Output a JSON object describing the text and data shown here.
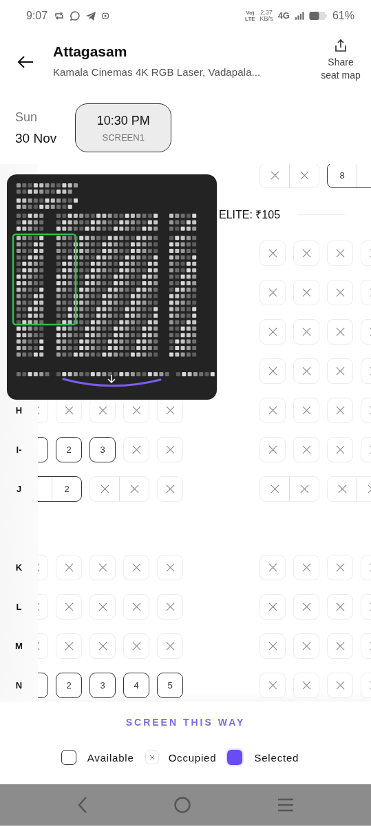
{
  "status_bar": {
    "time": "9:07",
    "volte_top": "Vo)",
    "volte_bottom": "LTE",
    "speed": "2.37",
    "speed_unit": "KB/s",
    "network": "4G",
    "battery": "61%"
  },
  "header": {
    "title": "Attagasam",
    "subtitle": "Kamala Cinemas 4K RGB Laser, Vadapala...",
    "share": "Share seat map"
  },
  "date": {
    "day": "Sun",
    "date": "30 Nov"
  },
  "showtimes": [
    {
      "time": "10:30 PM",
      "screen": "SCREEN1",
      "selected": true
    }
  ],
  "seat_rows": [
    {
      "kind": "row",
      "right": [
        [
          {
            "kind": "occupied"
          },
          {
            "kind": "occupied"
          }
        ],
        [
          {
            "kind": "available",
            "number": "8"
          },
          {
            "kind": "available"
          }
        ]
      ]
    },
    {
      "kind": "section",
      "label": "ELITE: ₹105"
    },
    {
      "kind": "row",
      "right": [
        [
          {
            "kind": "occupied"
          }
        ],
        [
          {
            "kind": "occupied"
          }
        ],
        [
          {
            "kind": "occupied"
          }
        ],
        [
          {
            "kind": "occupied"
          }
        ]
      ]
    },
    {
      "kind": "row",
      "right": [
        [
          {
            "kind": "occupied"
          }
        ],
        [
          {
            "kind": "occupied"
          }
        ],
        [
          {
            "kind": "occupied"
          }
        ],
        [
          {
            "kind": "occupied"
          }
        ]
      ]
    },
    {
      "kind": "row",
      "right": [
        [
          {
            "kind": "occupied"
          }
        ],
        [
          {
            "kind": "occupied"
          }
        ],
        [
          {
            "kind": "occupied"
          }
        ],
        [
          {
            "kind": "occupied"
          }
        ]
      ]
    },
    {
      "kind": "row",
      "right": [
        [
          {
            "kind": "occupied"
          }
        ],
        [
          {
            "kind": "occupied"
          }
        ],
        [
          {
            "kind": "occupied"
          }
        ],
        [
          {
            "kind": "occupied"
          }
        ]
      ]
    },
    {
      "kind": "row",
      "label": "H",
      "left": [
        [
          {
            "kind": "occupied"
          }
        ],
        [
          {
            "kind": "occupied"
          }
        ],
        [
          {
            "kind": "occupied"
          }
        ],
        [
          {
            "kind": "occupied"
          }
        ],
        [
          {
            "kind": "occupied"
          }
        ]
      ],
      "right": [
        [
          {
            "kind": "occupied"
          }
        ],
        [
          {
            "kind": "occupied"
          }
        ],
        [
          {
            "kind": "occupied"
          }
        ],
        [
          {
            "kind": "occupied"
          }
        ]
      ]
    },
    {
      "kind": "row",
      "label": "I-",
      "left": [
        [
          {
            "kind": "available"
          }
        ],
        [
          {
            "kind": "available",
            "number": "2"
          }
        ],
        [
          {
            "kind": "available",
            "number": "3"
          }
        ],
        [
          {
            "kind": "occupied"
          }
        ],
        [
          {
            "kind": "occupied"
          }
        ]
      ],
      "right": [
        [
          {
            "kind": "occupied"
          }
        ],
        [
          {
            "kind": "occupied"
          }
        ],
        [
          {
            "kind": "occupied"
          }
        ],
        [
          {
            "kind": "occupied"
          }
        ]
      ]
    },
    {
      "kind": "row",
      "label": "J",
      "left": [
        [
          {
            "kind": "available"
          },
          {
            "kind": "available",
            "number": "2"
          }
        ],
        [
          {
            "kind": "occupied"
          },
          {
            "kind": "occupied"
          }
        ],
        [
          {
            "kind": "occupied"
          }
        ]
      ],
      "right": [
        [
          {
            "kind": "occupied"
          },
          {
            "kind": "occupied"
          }
        ],
        [
          {
            "kind": "occupied"
          },
          {
            "kind": "occupied"
          }
        ]
      ]
    },
    {
      "kind": "gap"
    },
    {
      "kind": "row",
      "label": "K",
      "left": [
        [
          {
            "kind": "occupied"
          }
        ],
        [
          {
            "kind": "occupied"
          }
        ],
        [
          {
            "kind": "occupied"
          }
        ],
        [
          {
            "kind": "occupied"
          }
        ],
        [
          {
            "kind": "occupied"
          }
        ]
      ],
      "right": [
        [
          {
            "kind": "occupied"
          }
        ],
        [
          {
            "kind": "occupied"
          }
        ],
        [
          {
            "kind": "occupied"
          }
        ],
        [
          {
            "kind": "occupied"
          }
        ]
      ]
    },
    {
      "kind": "row",
      "label": "L",
      "left": [
        [
          {
            "kind": "occupied"
          }
        ],
        [
          {
            "kind": "occupied"
          }
        ],
        [
          {
            "kind": "occupied"
          }
        ],
        [
          {
            "kind": "occupied"
          }
        ],
        [
          {
            "kind": "occupied"
          }
        ]
      ],
      "right": [
        [
          {
            "kind": "occupied"
          }
        ],
        [
          {
            "kind": "occupied"
          }
        ],
        [
          {
            "kind": "occupied"
          }
        ],
        [
          {
            "kind": "occupied"
          }
        ]
      ]
    },
    {
      "kind": "row",
      "label": "M",
      "left": [
        [
          {
            "kind": "occupied"
          }
        ],
        [
          {
            "kind": "occupied"
          }
        ],
        [
          {
            "kind": "occupied"
          }
        ],
        [
          {
            "kind": "occupied"
          }
        ],
        [
          {
            "kind": "occupied"
          }
        ]
      ],
      "right": [
        [
          {
            "kind": "occupied"
          }
        ],
        [
          {
            "kind": "occupied"
          }
        ],
        [
          {
            "kind": "occupied"
          }
        ],
        [
          {
            "kind": "occupied"
          }
        ]
      ]
    },
    {
      "kind": "row",
      "label": "N",
      "left": [
        [
          {
            "kind": "available"
          }
        ],
        [
          {
            "kind": "available",
            "number": "2"
          }
        ],
        [
          {
            "kind": "available",
            "number": "3"
          }
        ],
        [
          {
            "kind": "available",
            "number": "4"
          }
        ],
        [
          {
            "kind": "available",
            "number": "5"
          }
        ]
      ],
      "right": [
        [
          {
            "kind": "occupied"
          }
        ],
        [
          {
            "kind": "occupied"
          }
        ],
        [
          {
            "kind": "occupied"
          }
        ],
        [
          {
            "kind": "occupied"
          }
        ]
      ]
    }
  ],
  "screen_label": "SCREEN THIS WAY",
  "legend": [
    {
      "kind": "available",
      "label": "Available"
    },
    {
      "kind": "occupied",
      "label": "Occupied"
    },
    {
      "kind": "selected",
      "label": "Selected"
    }
  ]
}
